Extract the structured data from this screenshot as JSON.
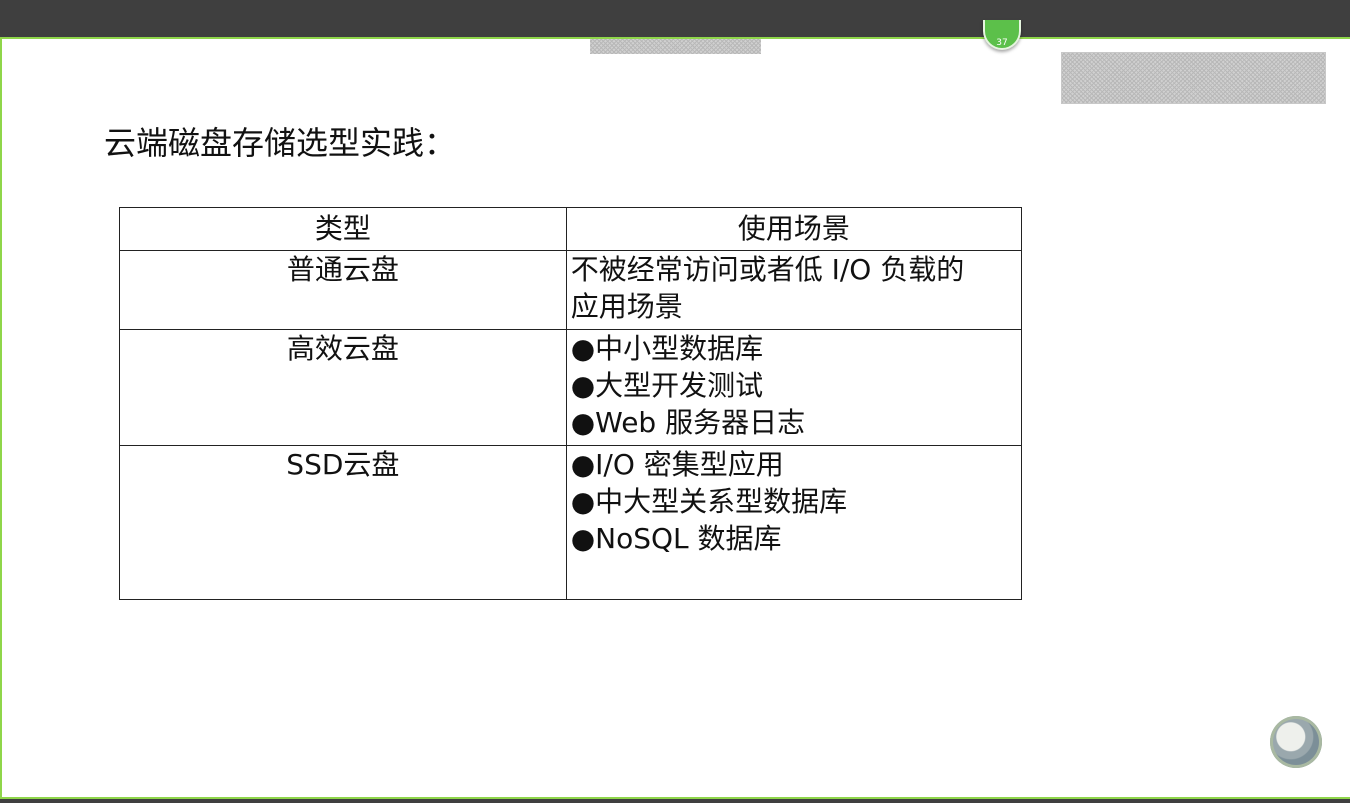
{
  "slide": {
    "title": "云端磁盘存储选型实践：",
    "page_number": "37"
  },
  "table": {
    "headers": [
      "类型",
      "使用场景"
    ],
    "rows": [
      {
        "type": "普通云盘",
        "scenarios": [
          "不被经常访问或者低 I/O 负载的",
          "应用场景"
        ]
      },
      {
        "type": "高效云盘",
        "scenarios": [
          "●中小型数据库",
          "●大型开发测试",
          "●Web 服务器日志"
        ]
      },
      {
        "type": "SSD云盘",
        "scenarios": [
          "●I/O 密集型应用",
          "●中大型关系型数据库",
          "●NoSQL 数据库"
        ]
      }
    ]
  },
  "icons": {
    "nav": "navigation-orb-icon"
  },
  "colors": {
    "top_bar": "#3f3f3f",
    "accent": "#8fd64a",
    "badge": "#5cc04a"
  }
}
